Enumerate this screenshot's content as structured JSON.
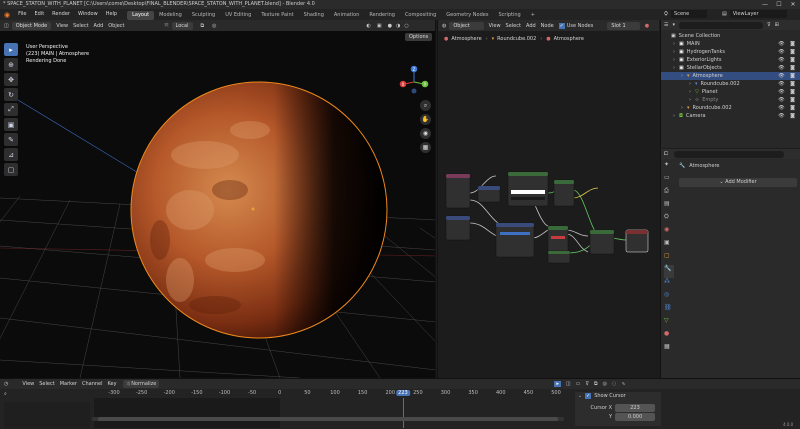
{
  "titlebar": {
    "title": "* SPACE_STATON_WITH_PLANET [C:\\Users\\come\\Desktop\\FINAL_BLENDER\\SPACE_STATON_WITH_PLANET.blend] - Blender 4.0",
    "minimize": "—",
    "maximize": "☐",
    "close": "✕"
  },
  "menubar": {
    "menus": [
      "File",
      "Edit",
      "Render",
      "Window",
      "Help"
    ],
    "workspaces": [
      "Layout",
      "Modeling",
      "Sculpting",
      "UV Editing",
      "Texture Paint",
      "Shading",
      "Animation",
      "Rendering",
      "Compositing",
      "Geometry Nodes",
      "Scripting"
    ],
    "add_workspace": "+",
    "scene": "Scene",
    "view_layer": "ViewLayer"
  },
  "viewport": {
    "mode": "Object Mode",
    "menus": [
      "View",
      "Select",
      "Add",
      "Object"
    ],
    "transform": "Local",
    "options": "Options",
    "info_line1": "User Perspective",
    "info_line2": "(223) MAIN | Atmosphere",
    "info_line3": "Rendering Done",
    "gizmo_x": "X",
    "gizmo_y": "Y",
    "gizmo_z": "Z"
  },
  "node_editor": {
    "object": "Object",
    "menus": [
      "View",
      "Select",
      "Add",
      "Node"
    ],
    "use_nodes": "Use Nodes",
    "slot": "Slot 1",
    "material": "Atmosphere",
    "breadcrumb": [
      "Atmosphere",
      "Roundcube.002",
      "Atmosphere"
    ]
  },
  "outliner": {
    "search_placeholder": "",
    "items": [
      {
        "label": "Scene Collection",
        "indent": 0,
        "selected": false
      },
      {
        "label": "MAIN",
        "indent": 1,
        "selected": false
      },
      {
        "label": "HydrogenTanks",
        "indent": 1,
        "selected": false
      },
      {
        "label": "ExteriorLights",
        "indent": 1,
        "selected": false
      },
      {
        "label": "StellarObjects",
        "indent": 1,
        "selected": false
      },
      {
        "label": "Atmosphere",
        "indent": 2,
        "selected": true
      },
      {
        "label": "Roundcube.002",
        "indent": 3,
        "selected": false
      },
      {
        "label": "Planet",
        "indent": 3,
        "selected": false
      },
      {
        "label": "Empty",
        "indent": 3,
        "selected": false
      },
      {
        "label": "Roundcube.002",
        "indent": 2,
        "selected": false
      },
      {
        "label": "Camera",
        "indent": 1,
        "selected": false
      }
    ]
  },
  "properties": {
    "object_name": "Atmosphere",
    "add_modifier": "Add Modifier"
  },
  "timeline": {
    "menus": [
      "View",
      "Select",
      "Marker",
      "Channel",
      "Key"
    ],
    "normalize": "Normalize",
    "ticks": [
      "-300",
      "-250",
      "-200",
      "-150",
      "-100",
      "-50",
      "0",
      "50",
      "100",
      "150",
      "200",
      "223",
      "250",
      "300",
      "350",
      "400",
      "450",
      "500"
    ],
    "current_frame": "223",
    "show_cursor": "Show Cursor",
    "cursor_x_label": "Cursor X",
    "cursor_x_value": "223",
    "cursor_y_label": "Y",
    "cursor_y_value": "0.000",
    "version": "4.0.0"
  }
}
